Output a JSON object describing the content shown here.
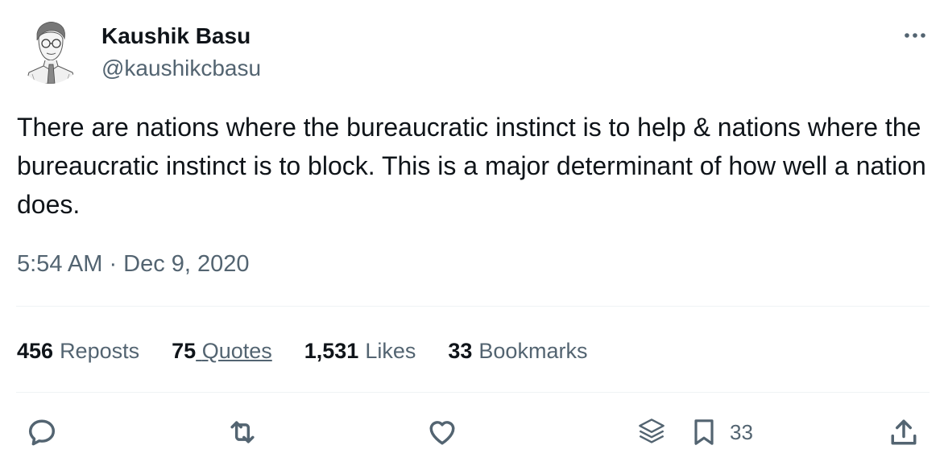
{
  "author": {
    "display_name": "Kaushik Basu",
    "handle": "@kaushikcbasu"
  },
  "tweet": {
    "text": "There are nations where the bureaucratic instinct is to help & nations where the bureaucratic instinct is to block. This is a major determinant of how well a nation does.",
    "timestamp": "5:54 AM · Dec 9, 2020"
  },
  "stats": {
    "reposts": {
      "count": "456",
      "label": "Reposts"
    },
    "quotes": {
      "count": "75",
      "label": "Quotes"
    },
    "likes": {
      "count": "1,531",
      "label": "Likes"
    },
    "bookmarks": {
      "count": "33",
      "label": "Bookmarks"
    }
  },
  "actions": {
    "bookmark_count": "33"
  },
  "icons": [
    "more-icon",
    "reply-icon",
    "repost-icon",
    "like-icon",
    "layers-icon",
    "bookmark-icon",
    "share-icon"
  ],
  "colors": {
    "text_primary": "#0f1419",
    "text_secondary": "#536471",
    "divider": "#eff3f4"
  }
}
